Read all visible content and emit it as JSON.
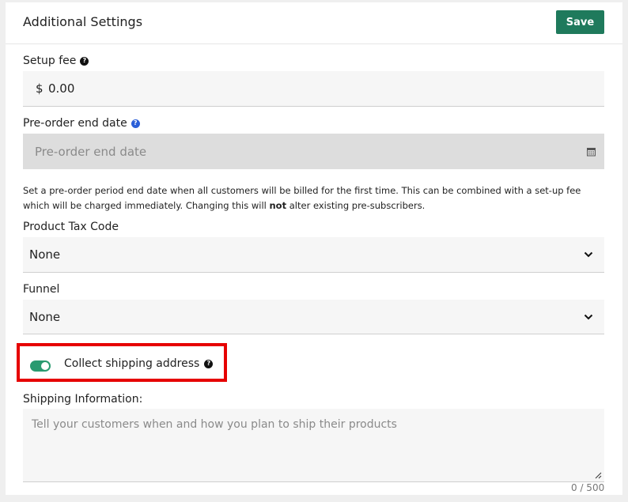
{
  "header": {
    "title": "Additional Settings",
    "save_label": "Save"
  },
  "setup_fee": {
    "label": "Setup fee",
    "currency": "$",
    "value": "0.00"
  },
  "preorder": {
    "label": "Pre-order end date",
    "placeholder": "Pre-order end date",
    "help_text_1": "Set a pre-order period end date when all customers will be billed for the first time. This can be combined with a set-up fee which will be charged immediately. Changing this will ",
    "help_text_bold": "not",
    "help_text_2": " alter existing pre-subscribers."
  },
  "tax_code": {
    "label": "Product Tax Code",
    "value": "None"
  },
  "funnel": {
    "label": "Funnel",
    "value": "None"
  },
  "shipping_toggle": {
    "label": "Collect shipping address",
    "checked": true
  },
  "shipping_info": {
    "label": "Shipping Information:",
    "placeholder": "Tell your customers when and how you plan to ship their products",
    "counter": "0 / 500"
  },
  "colors": {
    "accent": "#1f7a5c",
    "toggle_on": "#2a9a70",
    "highlight": "#e60000",
    "help_blue": "#2b5fd8"
  },
  "icons": [
    "help-icon",
    "calendar-icon",
    "chevron-down-icon",
    "resize-handle-icon"
  ]
}
